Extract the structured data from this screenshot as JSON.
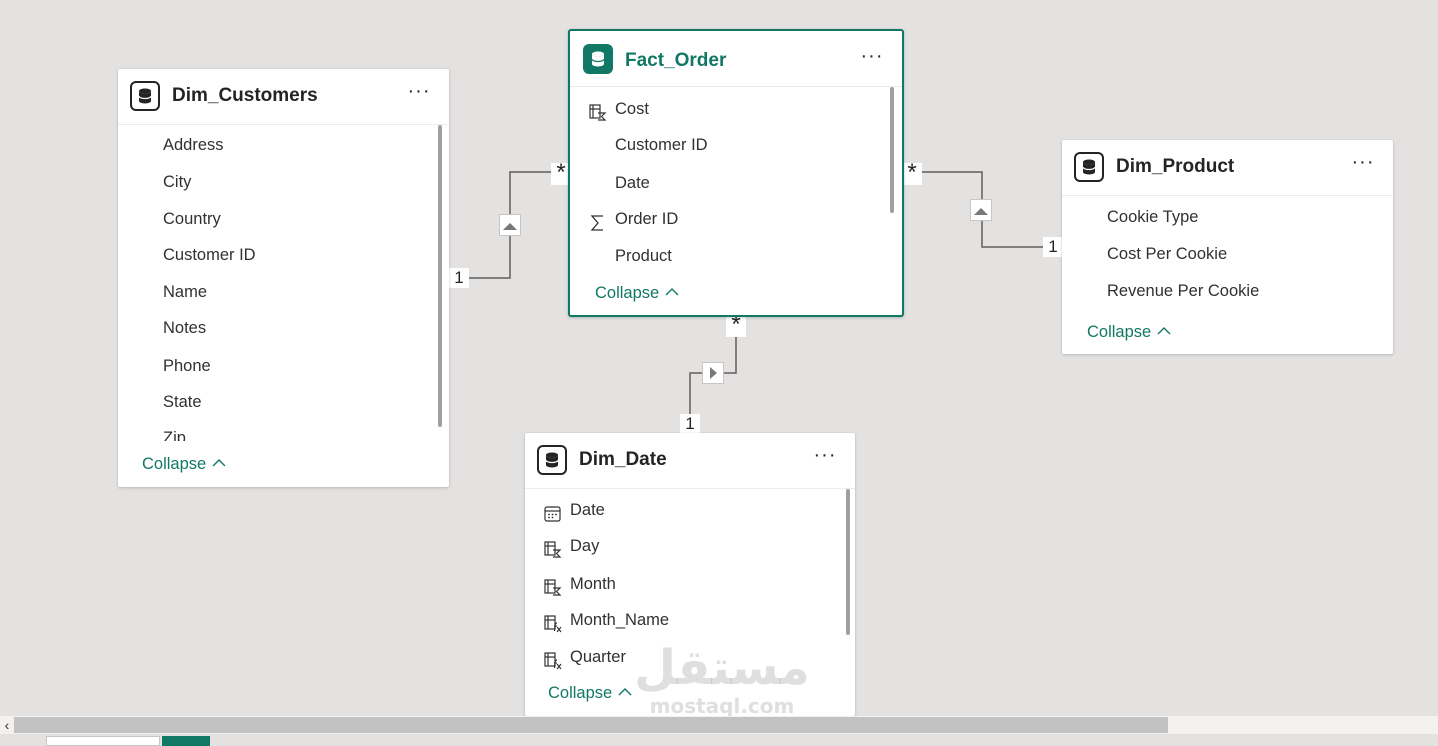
{
  "tables": {
    "customers": {
      "title": "Dim_Customers",
      "more_label": "···",
      "fields": [
        "Address",
        "City",
        "Country",
        "Customer ID",
        "Name",
        "Notes",
        "Phone",
        "State",
        "Zip"
      ],
      "collapse_label": "Collapse"
    },
    "order": {
      "title": "Fact_Order",
      "more_label": "···",
      "fields": [
        {
          "label": "Cost",
          "icon": "calculated-column-icon"
        },
        {
          "label": "Customer ID",
          "icon": ""
        },
        {
          "label": "Date",
          "icon": ""
        },
        {
          "label": "Order ID",
          "icon": "sigma-icon"
        },
        {
          "label": "Product",
          "icon": ""
        }
      ],
      "collapse_label": "Collapse"
    },
    "product": {
      "title": "Dim_Product",
      "more_label": "···",
      "fields": [
        "Cookie Type",
        "Cost Per Cookie",
        "Revenue Per Cookie"
      ],
      "collapse_label": "Collapse"
    },
    "date": {
      "title": "Dim_Date",
      "more_label": "···",
      "fields": [
        {
          "label": "Date",
          "icon": "calendar-icon"
        },
        {
          "label": "Day",
          "icon": "calculated-column-icon"
        },
        {
          "label": "Month",
          "icon": "calculated-column-icon"
        },
        {
          "label": "Month_Name",
          "icon": "calculated-fx-icon"
        },
        {
          "label": "Quarter",
          "icon": "calculated-fx-icon"
        }
      ],
      "collapse_label": "Collapse"
    }
  },
  "relationships": {
    "customers_order": {
      "one": "1",
      "many": "*"
    },
    "product_order": {
      "one": "1",
      "many": "*"
    },
    "date_order": {
      "one": "1",
      "many": "*"
    }
  },
  "colors": {
    "accent": "#117865",
    "canvas": "#e3e2e1",
    "line": "#605e5c"
  },
  "watermark": {
    "arabic": "مستقل",
    "latin": "mostaql.com"
  }
}
